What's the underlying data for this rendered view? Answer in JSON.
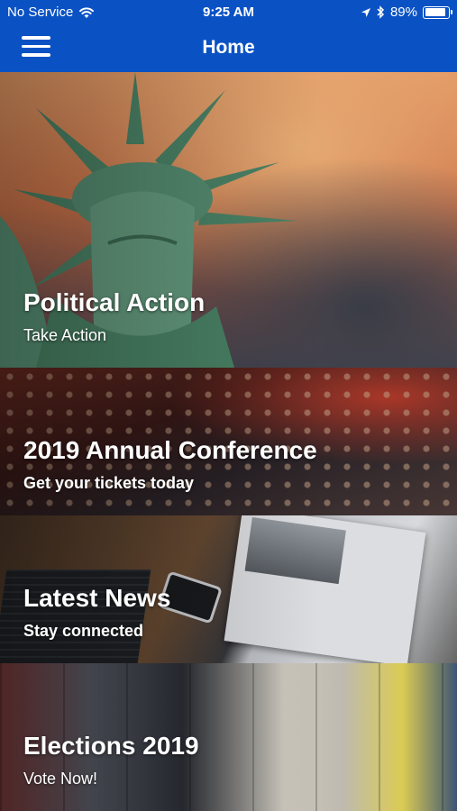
{
  "status_bar": {
    "carrier": "No Service",
    "time": "9:25 AM",
    "battery_percent": "89%",
    "battery_level": 0.89
  },
  "nav": {
    "title": "Home",
    "menu_icon": "hamburger-menu-icon"
  },
  "colors": {
    "nav_blue": "#0a52c4",
    "text_white": "#ffffff"
  },
  "tiles": [
    {
      "title": "Political Action",
      "subtitle": "Take Action",
      "image": "statue-of-liberty"
    },
    {
      "title": "2019 Annual Conference",
      "subtitle": "Get your tickets today",
      "image": "conference-audience"
    },
    {
      "title": "Latest News",
      "subtitle": "Stay connected",
      "image": "newspaper-laptop-desk"
    },
    {
      "title": "Elections 2019",
      "subtitle": "Vote Now!",
      "image": "people-standing"
    }
  ]
}
